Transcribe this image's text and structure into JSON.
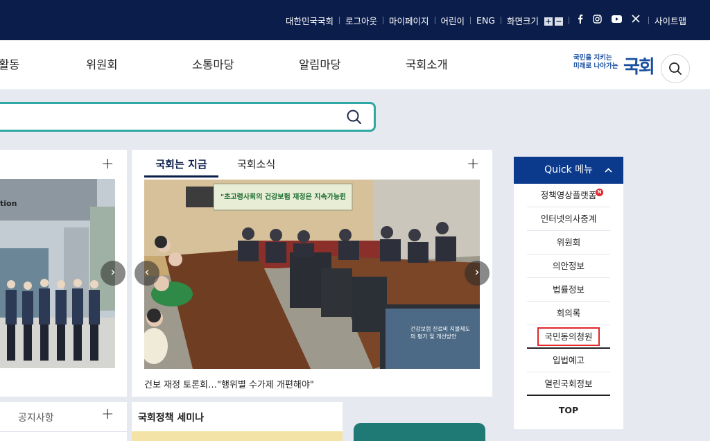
{
  "utility_bar": {
    "links": [
      "대한민국국회",
      "로그아웃",
      "마이페이지",
      "어린이",
      "ENG"
    ],
    "font_size_label": "화면크기",
    "font_plus": "+",
    "font_minus": "−",
    "sitemap_label": "사이트맵"
  },
  "gnb": {
    "menus": [
      "활동",
      "위원회",
      "소통마당",
      "알림마당",
      "국회소개"
    ]
  },
  "logo": {
    "line1": "국민을 지키는",
    "line2": "미래로 나아가는",
    "mark": "국회"
  },
  "search": {
    "placeholder": "",
    "value": ""
  },
  "news": {
    "tabs": [
      "국회는 지금",
      "국회소식"
    ],
    "caption": "건보 재정 토론회…\"행위별 수가제 개편해야\"",
    "banner_text": "\"초고령사회의 건강보험 재정은 지속가능한가\"",
    "screen_text": "건강보험 진료비 지불제도의 평가 및 개선방안",
    "left_photo_text": "tion"
  },
  "bottom_cards": {
    "notice_label": "공지사항",
    "seminar_label": "국회정책 세미나"
  },
  "quick_menu": {
    "title": "Quick 메뉴",
    "items": [
      "정책영상플랫폼",
      "인터넷의사중계",
      "위원회",
      "의안정보",
      "법률정보",
      "회의록",
      "국민동의청원",
      "입법예고",
      "열린국회정보"
    ],
    "badge": "N",
    "top_label": "TOP"
  },
  "colors": {
    "navy": "#0b1d4a",
    "quick_head": "#0b3a8c",
    "search_border": "#2fa7a3",
    "highlight": "#e2262a"
  }
}
